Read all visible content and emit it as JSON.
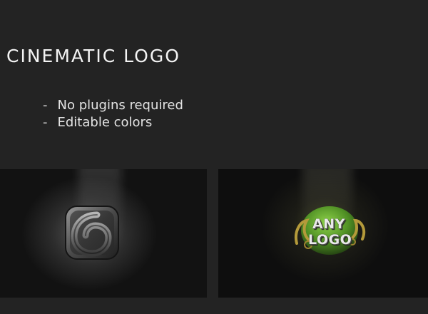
{
  "slide": {
    "title": "CINEMATIC LOGO",
    "features": [
      {
        "dash": "-",
        "text": "No plugins required"
      },
      {
        "dash": "-",
        "text": "Editable colors"
      }
    ]
  },
  "previews": {
    "left": {
      "icon": "metallic-logo-icon"
    },
    "right": {
      "icon": "ornate-leaf-icon",
      "logo_line1": "ANY",
      "logo_line2": "LOGO"
    }
  },
  "colors": {
    "background": "#232323",
    "text": "#f4f4f4",
    "accent_green": "#5f9b2e",
    "accent_gold": "#b49a3a"
  }
}
